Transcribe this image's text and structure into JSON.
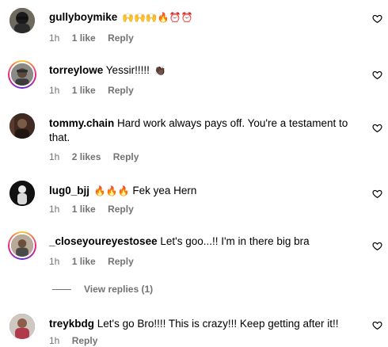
{
  "comments": [
    {
      "username": "gullyboymike",
      "text": "",
      "emojis": "🙌🙌🙌🔥⏰⏰",
      "time": "1h",
      "likes": "1 like",
      "reply": "Reply"
    },
    {
      "username": "torreylowe",
      "text": "Yessir!!!!!",
      "emojis": "👏🏿",
      "time": "1h",
      "likes": "1 like",
      "reply": "Reply"
    },
    {
      "username": "tommy.chain",
      "text": "Hard work always pays off. You're a testament to that.",
      "emojis": "",
      "time": "1h",
      "likes": "2 likes",
      "reply": "Reply"
    },
    {
      "username": "lug0_bjj",
      "text": "Fek yea Hern",
      "emojis": "🔥🔥🔥",
      "time": "1h",
      "likes": "1 like",
      "reply": "Reply"
    },
    {
      "username": "_closeyoureyestosee",
      "text": "Let's goo...!! I'm in there big bra",
      "emojis": "",
      "time": "1h",
      "likes": "1 like",
      "reply": "Reply",
      "view_replies": "View replies (1)"
    },
    {
      "username": "treykbdg",
      "text": "Let's go Bro!!!! This is crazy!!! Keep getting after it!!",
      "emojis": "",
      "time": "1h",
      "likes": "",
      "reply": "Reply"
    }
  ],
  "colors": {
    "meta_gray": "#737373",
    "story_ring": [
      "#f9ce34",
      "#ee2a7b",
      "#6228d7"
    ]
  },
  "icons": {
    "like": "heart-outline-icon"
  }
}
